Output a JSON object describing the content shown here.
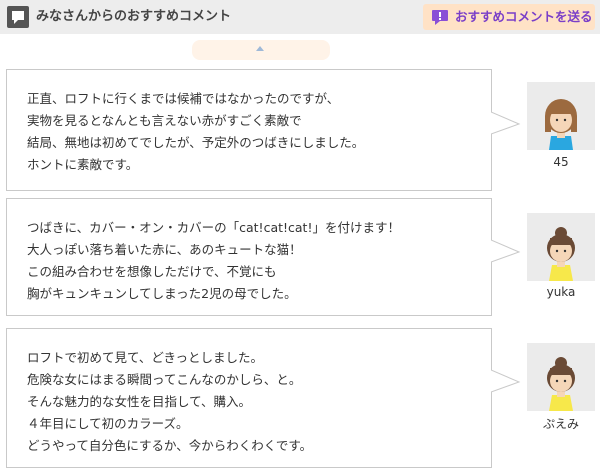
{
  "header": {
    "title": "みなさんからのおすすめコメント",
    "send_button": "おすすめコメントを送る"
  },
  "comments": [
    {
      "lines": [
        "正直、ロフトに行くまでは候補ではなかったのですが、",
        "実物を見るとなんとも言えない赤がすごく素敵で",
        "結局、無地は初めてでしたが、予定外のつばきにしました。",
        "ホントに素敵です。"
      ],
      "user": "45"
    },
    {
      "lines": [
        "つばきに、カバー・オン・カバーの「cat!cat!cat!」を付けます！",
        "大人っぽい落ち着いた赤に、あのキュートな猫！",
        "この組み合わせを想像しただけで、不覚にも",
        "胸がキュンキュンしてしまった2児の母でした。"
      ],
      "user": "yuka"
    },
    {
      "lines": [
        "ロフトで初めて見て、どきっとしました。",
        "危険な女にはまる瞬間ってこんなのかしら、と。",
        "そんな魅力的な女性を目指して、購入。",
        "４年目にして初のカラーズ。",
        "どうやって自分色にするか、今からわくわくです。"
      ],
      "user": "ぷえみ"
    }
  ]
}
